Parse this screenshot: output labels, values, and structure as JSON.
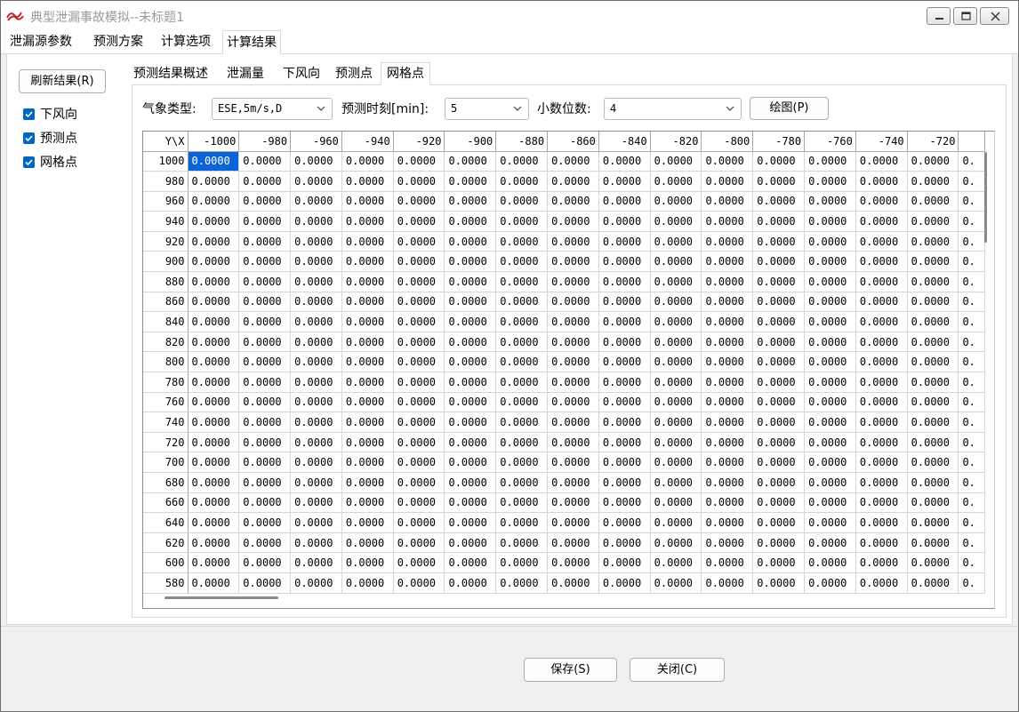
{
  "window": {
    "title": "典型泄漏事故模拟--未标题1",
    "minimize_icon": "minimize-icon",
    "maximize_icon": "maximize-icon",
    "close_icon": "close-icon"
  },
  "main_tabs": [
    "泄漏源参数",
    "预测方案",
    "计算选项",
    "计算结果"
  ],
  "main_tab_active": "计算结果",
  "sidebar": {
    "refresh_label": "刷新结果(R)",
    "checkboxes": [
      {
        "label": "下风向",
        "checked": true
      },
      {
        "label": "预测点",
        "checked": true
      },
      {
        "label": "网格点",
        "checked": true
      }
    ]
  },
  "sub_tabs": [
    "预测结果概述",
    "泄漏量",
    "下风向",
    "预测点",
    "网格点"
  ],
  "sub_tab_active": "网格点",
  "controls": {
    "weather_label": "气象类型:",
    "weather_value": "ESE,5m/s,D",
    "time_label": "预测时刻[min]:",
    "time_value": "5",
    "decimals_label": "小数位数:",
    "decimals_value": "4",
    "draw_label": "绘图(P)"
  },
  "grid": {
    "corner": "Y\\X",
    "columns": [
      "-1000",
      "-980",
      "-960",
      "-940",
      "-920",
      "-900",
      "-880",
      "-860",
      "-840",
      "-820",
      "-800",
      "-780",
      "-760",
      "-740",
      "-720"
    ],
    "rows": [
      "1000",
      "980",
      "960",
      "940",
      "920",
      "900",
      "880",
      "860",
      "840",
      "820",
      "800",
      "780",
      "760",
      "740",
      "720",
      "700",
      "680",
      "660",
      "640",
      "620",
      "600",
      "580"
    ],
    "cell_value": "0.0000",
    "partial_cell": "0.",
    "selected_cell": {
      "row": 0,
      "col": 0
    }
  },
  "footer": {
    "save_label": "保存(S)",
    "close_label": "关闭(C)"
  },
  "colors": {
    "selection": "#0a64d8",
    "checkbox": "#0067c0",
    "title_text": "#9a9a9a"
  }
}
